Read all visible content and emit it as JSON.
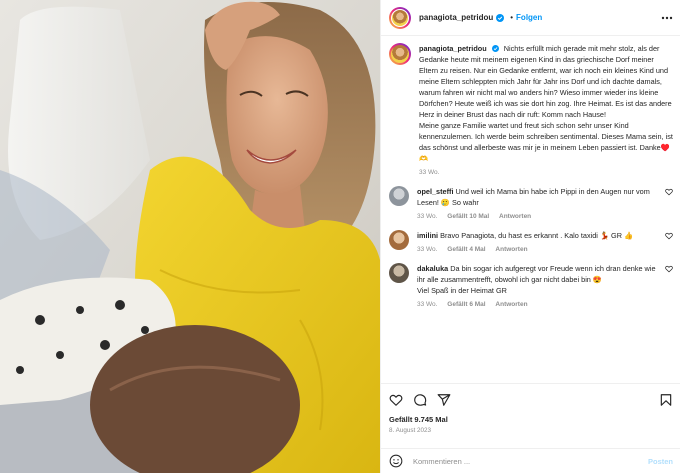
{
  "post": {
    "author": "panagiota_petridou",
    "follow_label": "Folgen",
    "dot": "•",
    "caption": "Nichts erfüllt mich gerade mit mehr stolz, als der Gedanke heute mit meinem eigenen Kind in das griechische Dorf meiner Eltern zu reisen. Nur ein Gedanke entfernt, war ich noch ein kleines Kind und meine Eltern schleppten mich Jahr für Jahr ins Dorf und ich dachte damals, warum fahren wir nicht mal wo anders hin? Wieso immer wieder ins kleine Dörfchen? Heute weiß ich was sie dort hin zog. Ihre Heimat. Es ist das andere Herz in deiner Brust das nach dir ruft: Komm nach Hause!\nMeine ganze Familie wartet und freut sich schon sehr unser Kind kennenzulernen. Ich werde beim schreiben sentimental. Dieses Mama sein, ist das schönst und allerbeste was mir je in meinem Leben passiert ist. Danke♥️ 🫶",
    "caption_age": "33 Wo.",
    "likes": "Gefällt 9.745 Mal",
    "date": "8. August 2023"
  },
  "comments": [
    {
      "user": "opel_steffi",
      "text": "Und weil ich Mama bin habe ich Pippi in den Augen nur vom Lesen! 🥲 So wahr",
      "age": "33 Wo.",
      "likes": "Gefällt 10 Mal",
      "reply": "Antworten"
    },
    {
      "user": "imilini",
      "text": "Bravo Panagiota, du hast es erkannt . Kalo taxidi 💃 GR 👍",
      "age": "33 Wo.",
      "likes": "Gefällt 4 Mal",
      "reply": "Antworten"
    },
    {
      "user": "dakaluka",
      "text": "Da bin sogar ich aufgeregt vor Freude wenn ich dran denke wie ihr alle zusammentrefft, obwohl ich gar nicht dabei bin 😍\nViel Spaß in der Heimat GR",
      "age": "33 Wo.",
      "likes": "Gefällt 6 Mal",
      "reply": "Antworten"
    }
  ],
  "add_comment": {
    "placeholder": "Kommentieren ...",
    "post_label": "Posten"
  },
  "colors": {
    "accent": "#0095f6",
    "verified": "#0095f6",
    "muted": "#8e8e8e",
    "post_disabled": "#b2dffc"
  },
  "icons": [
    "verified-icon",
    "more-icon",
    "heart-icon",
    "comment-icon",
    "share-icon",
    "save-icon",
    "emoji-icon"
  ]
}
